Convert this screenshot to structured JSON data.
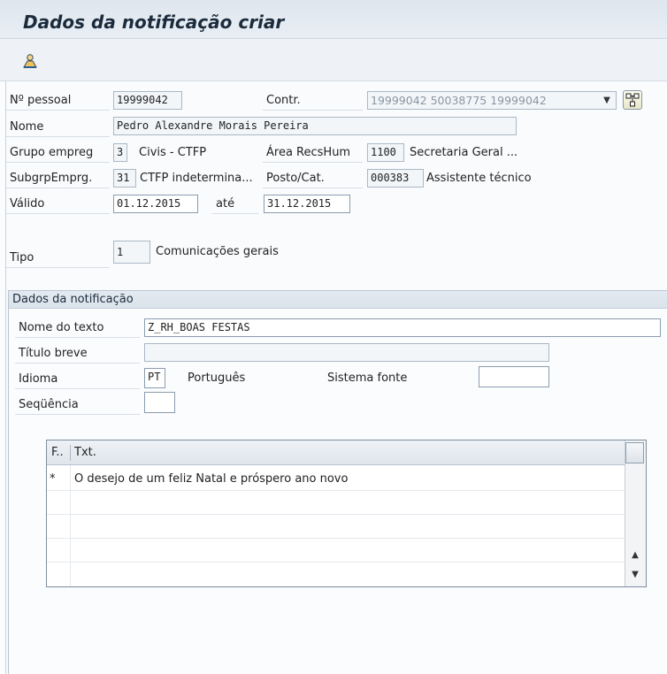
{
  "window": {
    "title": "Dados da notificação criar"
  },
  "toolbar": {
    "icon": "person-icon"
  },
  "header": {
    "pernr": {
      "label": "Nº pessoal",
      "value": "19999042"
    },
    "contr": {
      "label": "Contr.",
      "value": "19999042 50038775 19999042"
    },
    "nome": {
      "label": "Nome",
      "value": "Pedro Alexandre Morais Pereira"
    },
    "grupo": {
      "label": "Grupo empreg",
      "code": "3",
      "text": "Civis - CTFP"
    },
    "area": {
      "label": "Área RecsHum",
      "code": "1100",
      "text": "Secretaria Geral ..."
    },
    "subgrp": {
      "label": "SubgrpEmprg.",
      "code": "31",
      "text": "CTFP indetermina..."
    },
    "posto": {
      "label": "Posto/Cat.",
      "code": "000383",
      "text": "Assistente técnico"
    },
    "valido": {
      "label": "Válido",
      "from": "01.12.2015",
      "to_label": "até",
      "to": "31.12.2015"
    },
    "tipo": {
      "label": "Tipo",
      "code": "1",
      "text": "Comunicações gerais"
    }
  },
  "notification": {
    "title": "Dados da notificação",
    "nome_texto": {
      "label": "Nome do texto",
      "value": "Z_RH_BOAS FESTAS"
    },
    "titulo": {
      "label": "Título breve",
      "value": ""
    },
    "idioma": {
      "label": "Idioma",
      "code": "PT",
      "text": "Português"
    },
    "sistema": {
      "label": "Sistema fonte",
      "value": ""
    },
    "sequencia": {
      "label": "Seqüência",
      "value": ""
    }
  },
  "table": {
    "columns": [
      "F..",
      "Txt."
    ],
    "rows": [
      {
        "f": "*",
        "txt": "O desejo de um feliz Natal e próspero ano novo"
      }
    ]
  }
}
